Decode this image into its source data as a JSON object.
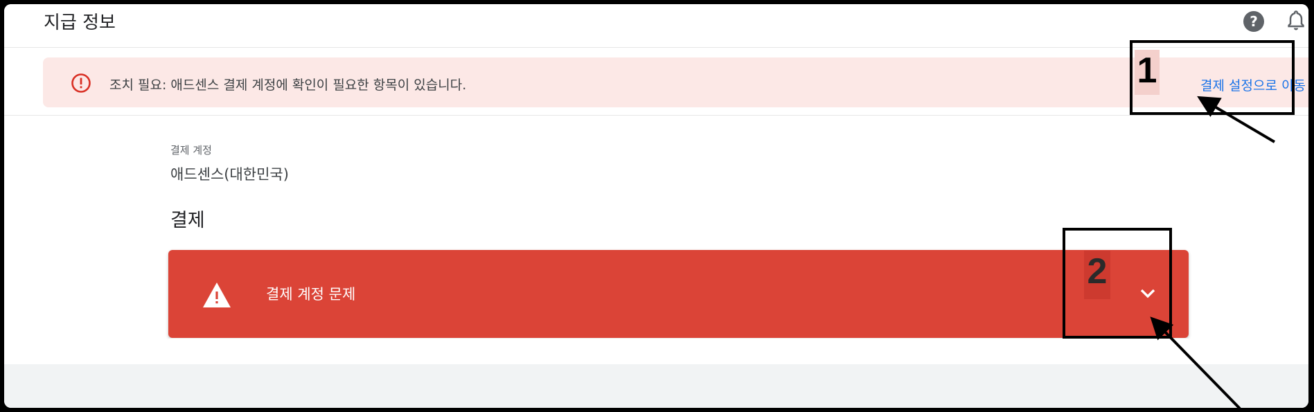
{
  "header": {
    "title": "지급 정보",
    "help_glyph": "?",
    "icons": [
      "help-icon",
      "bell-icon"
    ]
  },
  "alert": {
    "icon": "error-circle-icon",
    "message": "조치 필요: 애드센스 결제 계정에 확인이 필요한 항목이 있습니다.",
    "link_label": "결제 설정으로 이동"
  },
  "billing_account": {
    "label": "결제 계정",
    "value": "애드센스(대한민국)"
  },
  "payment_section": {
    "title": "결제",
    "issue_card": {
      "icon": "warning-triangle-icon",
      "title": "결제 계정 문제",
      "expand_icon": "chevron-down-icon"
    }
  },
  "annotations": {
    "step1": "1",
    "step2": "2"
  },
  "colors": {
    "alert_bg": "#fce8e6",
    "alert_icon": "#d93025",
    "link": "#1a73e8",
    "issue_card": "#db4437"
  }
}
